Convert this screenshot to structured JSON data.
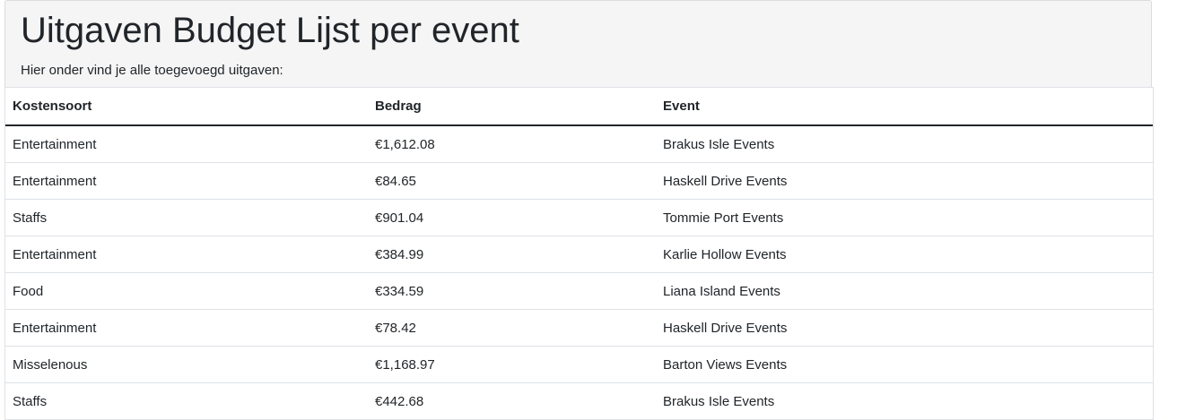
{
  "header": {
    "title": "Uitgaven Budget Lijst per event",
    "subtitle": "Hier onder vind je alle toegevoegd uitgaven:"
  },
  "table": {
    "columns": [
      "Kostensoort",
      "Bedrag",
      "Event"
    ],
    "rows": [
      [
        "Entertainment",
        "€1,612.08",
        "Brakus Isle Events"
      ],
      [
        "Entertainment",
        "€84.65",
        "Haskell Drive Events"
      ],
      [
        "Staffs",
        "€901.04",
        "Tommie Port Events"
      ],
      [
        "Entertainment",
        "€384.99",
        "Karlie Hollow Events"
      ],
      [
        "Food",
        "€334.59",
        "Liana Island Events"
      ],
      [
        "Entertainment",
        "€78.42",
        "Haskell Drive Events"
      ],
      [
        "Misselenous",
        "€1,168.97",
        "Barton Views Events"
      ],
      [
        "Staffs",
        "€442.68",
        "Brakus Isle Events"
      ]
    ]
  }
}
